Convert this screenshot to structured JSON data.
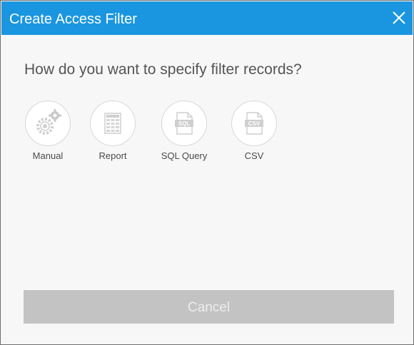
{
  "dialog": {
    "title": "Create Access Filter",
    "question": "How do you want to specify filter records?",
    "options": [
      {
        "label": "Manual",
        "icon": "gears-icon"
      },
      {
        "label": "Report",
        "icon": "report-table-icon"
      },
      {
        "label": "SQL Query",
        "icon": "sql-file-icon",
        "badge": "SQL"
      },
      {
        "label": "CSV",
        "icon": "csv-file-icon",
        "badge": "CSV"
      }
    ],
    "cancel_label": "Cancel"
  },
  "colors": {
    "header": "#1a96e0",
    "background": "#f7f7f7",
    "button": "#c3c3c3",
    "icon": "#d2d2d2"
  }
}
